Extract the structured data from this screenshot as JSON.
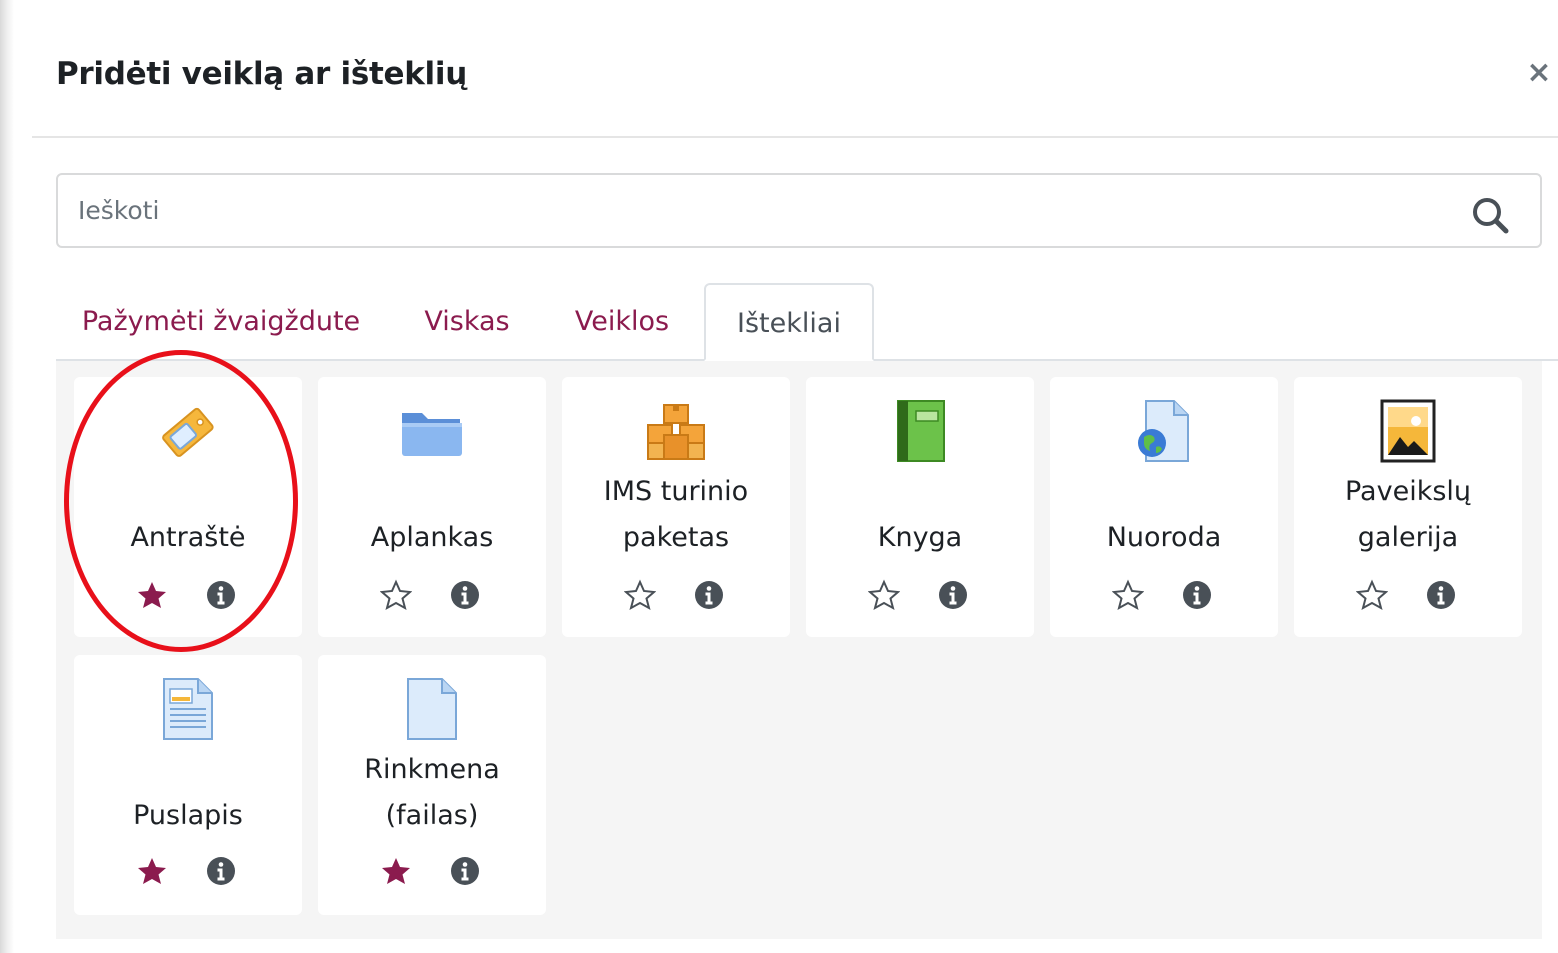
{
  "dialog": {
    "title": "Pridėti veiklą ar išteklių",
    "close_symbol": "×"
  },
  "search": {
    "placeholder": "Ieškoti",
    "icon": "search-icon"
  },
  "tabs": [
    {
      "label": "Pažymėti žvaigždute",
      "active": false
    },
    {
      "label": "Viskas",
      "active": false
    },
    {
      "label": "Veiklos",
      "active": false
    },
    {
      "label": "Ištekliai",
      "active": true
    }
  ],
  "items": [
    {
      "label_lines": [
        "Antraštė"
      ],
      "icon": "label-tag-icon",
      "starred": true
    },
    {
      "label_lines": [
        "Aplankas"
      ],
      "icon": "folder-icon",
      "starred": false
    },
    {
      "label_lines": [
        "IMS turinio",
        "paketas"
      ],
      "icon": "ims-package-icon",
      "starred": false
    },
    {
      "label_lines": [
        "Knyga"
      ],
      "icon": "book-icon",
      "starred": false
    },
    {
      "label_lines": [
        "Nuoroda"
      ],
      "icon": "url-globe-icon",
      "starred": false
    },
    {
      "label_lines": [
        "Paveikslų",
        "galerija"
      ],
      "icon": "image-gallery-icon",
      "starred": false
    },
    {
      "label_lines": [
        "Puslapis"
      ],
      "icon": "page-icon",
      "starred": true
    },
    {
      "label_lines": [
        "Rinkmena",
        "(failas)"
      ],
      "icon": "file-icon",
      "starred": true
    }
  ],
  "colors": {
    "accent": "#8b1b4e",
    "highlight_circle": "#e8101a",
    "info_icon": "#495057"
  }
}
